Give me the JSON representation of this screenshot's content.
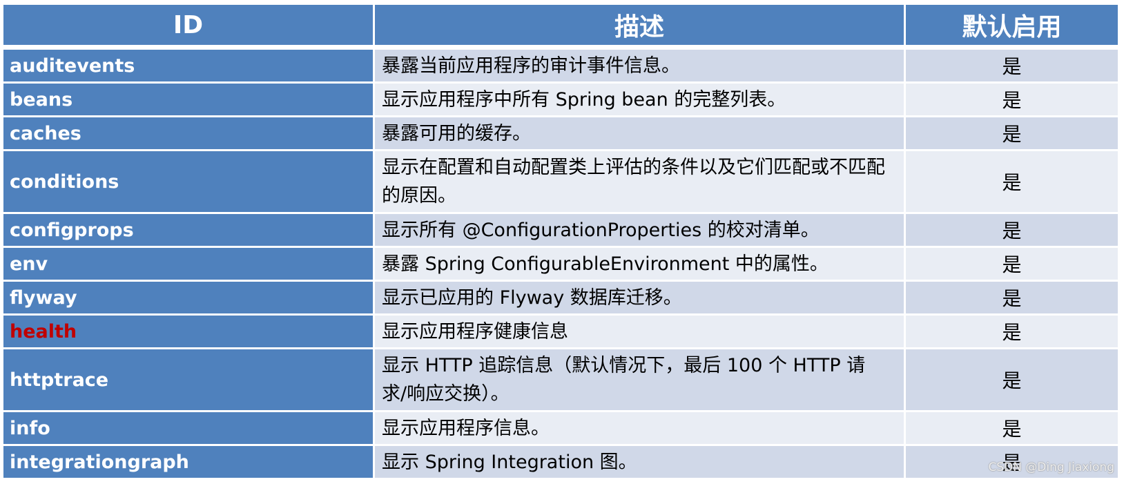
{
  "table": {
    "headers": {
      "id": "ID",
      "description": "描述",
      "enabled": "默认启用"
    },
    "colors": {
      "header_bg": "#4f81bd",
      "row_dark": "#d0d8e8",
      "row_light": "#e9edf4",
      "highlight_text": "#c00000"
    },
    "rows": [
      {
        "id": "auditevents",
        "description": "暴露当前应用程序的审计事件信息。",
        "enabled": "是"
      },
      {
        "id": "beans",
        "description": "显示应用程序中所有 Spring bean 的完整列表。",
        "enabled": "是"
      },
      {
        "id": "caches",
        "description": "暴露可用的缓存。",
        "enabled": "是"
      },
      {
        "id": "conditions",
        "description": "显示在配置和自动配置类上评估的条件以及它们匹配或不匹配的原因。",
        "enabled": "是"
      },
      {
        "id": "configprops",
        "description": "显示所有 @ConfigurationProperties 的校对清单。",
        "enabled": "是"
      },
      {
        "id": "env",
        "description": "暴露 Spring ConfigurableEnvironment 中的属性。",
        "enabled": "是"
      },
      {
        "id": "flyway",
        "description": "显示已应用的 Flyway 数据库迁移。",
        "enabled": "是"
      },
      {
        "id": "health",
        "description": "显示应用程序健康信息",
        "enabled": "是",
        "highlighted": true
      },
      {
        "id": "httptrace",
        "description": "显示 HTTP 追踪信息（默认情况下，最后 100 个 HTTP 请求/响应交换）。",
        "enabled": "是"
      },
      {
        "id": "info",
        "description": "显示应用程序信息。",
        "enabled": "是"
      },
      {
        "id": "integrationgraph",
        "description": "显示 Spring Integration 图。",
        "enabled": "是"
      }
    ]
  },
  "watermark": "CSDN @Ding Jiaxiong"
}
